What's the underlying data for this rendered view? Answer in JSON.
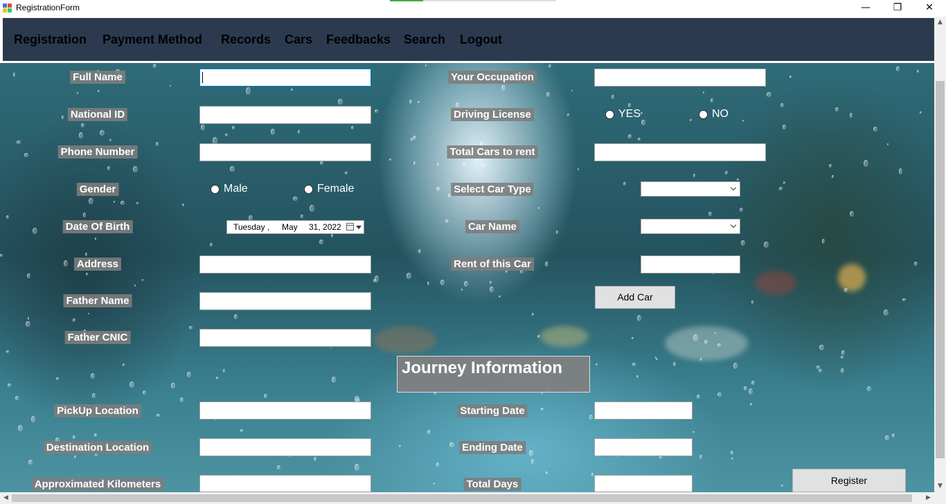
{
  "window": {
    "title": "RegistrationForm",
    "minimize_glyph": "—",
    "restore_glyph": "❐",
    "close_glyph": "✕",
    "progress": 0.2
  },
  "menu": [
    "Registration",
    "Payment Method",
    "Records",
    "Cars",
    "Feedbacks",
    "Search",
    "Logout"
  ],
  "personal": {
    "full_name": "Full Name",
    "national_id": "National ID",
    "phone_number": "Phone Number",
    "gender": "Gender",
    "gender_male": "Male",
    "gender_female": "Female",
    "date_of_birth": "Date Of Birth",
    "dob_day": "Tuesday",
    "dob_sep": ",",
    "dob_month": "May",
    "dob_date": "31, 2022",
    "address": "Address",
    "father_name": "Father Name",
    "father_cnic": "Father CNIC"
  },
  "car": {
    "occupation": "Your Occupation",
    "driving_license": "Driving License",
    "license_yes": "YES",
    "license_no": "NO",
    "total_cars": "Total Cars to rent",
    "select_car_type": "Select Car Type",
    "car_name": "Car Name",
    "rent": "Rent of this Car",
    "add_car": "Add Car"
  },
  "journey": {
    "heading": "Journey Information",
    "pickup": "PickUp Location",
    "destination": "Destination Location",
    "kilometers": "Approximated Kilometers",
    "starting_date": "Starting Date",
    "ending_date": "Ending Date",
    "total_days": "Total Days",
    "register": "Register"
  },
  "scrollbar": {
    "up": "▲",
    "down": "▼",
    "left": "◀",
    "right": "▶"
  }
}
